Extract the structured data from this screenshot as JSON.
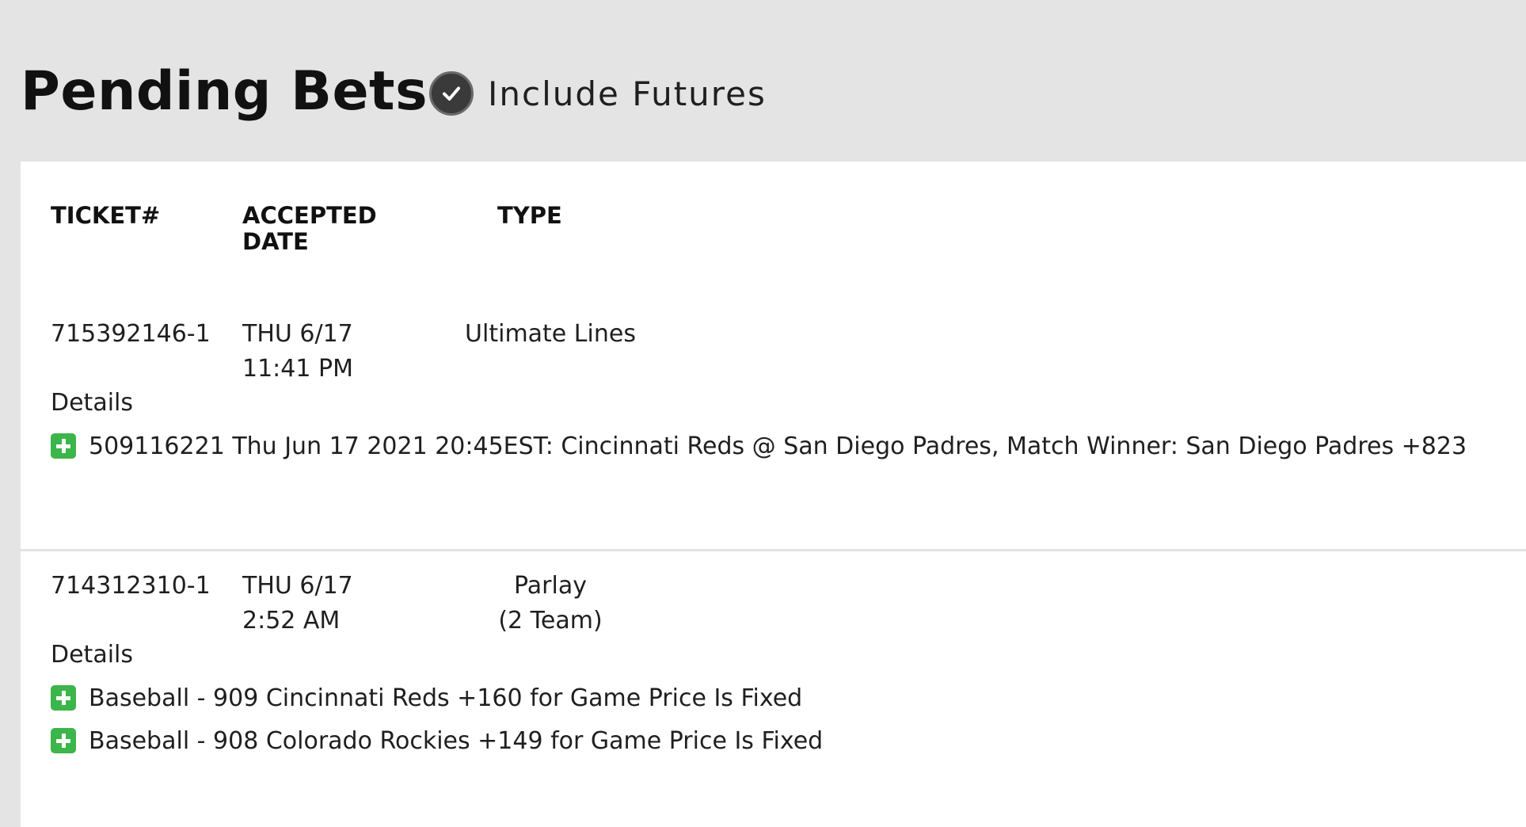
{
  "header": {
    "title": "Pending Bets",
    "include_futures_label": "Include Futures",
    "include_futures_checked": true
  },
  "table": {
    "columns": {
      "ticket_line1": "TICKET#",
      "accepted_line1": "ACCEPTED",
      "accepted_line2": "DATE",
      "type_line1": "TYPE"
    },
    "rows": [
      {
        "ticket": "715392146-1",
        "date": "THU 6/17",
        "time": "11:41 PM",
        "type_line1": "Ultimate Lines",
        "type_line2": "",
        "details_label": "Details",
        "details": [
          "509116221 Thu Jun 17 2021 20:45EST: Cincinnati Reds @ San Diego Padres, Match Winner: San Diego Padres +823"
        ]
      },
      {
        "ticket": "714312310-1",
        "date": "THU 6/17",
        "time": "2:52 AM",
        "type_line1": "Parlay",
        "type_line2": "(2 Team)",
        "details_label": "Details",
        "details": [
          "Baseball - 909 Cincinnati Reds +160 for Game Price Is Fixed",
          "Baseball - 908 Colorado Rockies +149 for Game Price Is Fixed"
        ]
      }
    ]
  },
  "colors": {
    "background": "#e4e4e4",
    "panel": "#ffffff",
    "expand_icon": "#3cb54a",
    "check_badge": "#3a3a3a"
  }
}
